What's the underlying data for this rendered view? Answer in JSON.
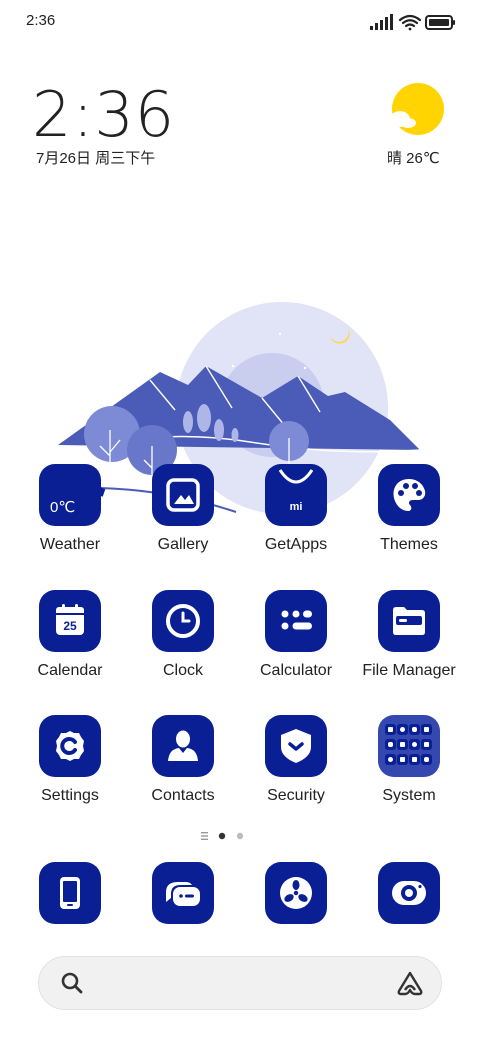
{
  "status": {
    "time": "2:36"
  },
  "lockscreen": {
    "clock": "2:36",
    "date": "7月26日 周三下午",
    "weather": "晴 26℃"
  },
  "apps": [
    {
      "label": "Weather",
      "tile_text": "0℃"
    },
    {
      "label": "Gallery"
    },
    {
      "label": "GetApps",
      "tile_text": "mi"
    },
    {
      "label": "Themes"
    },
    {
      "label": "Calendar",
      "tile_text": "25"
    },
    {
      "label": "Clock"
    },
    {
      "label": "Calculator"
    },
    {
      "label": "File Manager"
    },
    {
      "label": "Settings"
    },
    {
      "label": "Contacts"
    },
    {
      "label": "Security"
    },
    {
      "label": "System"
    }
  ],
  "dock": [
    "phone-icon",
    "messages-icon",
    "browser-icon",
    "camera-icon"
  ],
  "colors": {
    "accent": "#0a1f94",
    "sun": "#ffd400",
    "mountain": "#4a5bb8"
  }
}
